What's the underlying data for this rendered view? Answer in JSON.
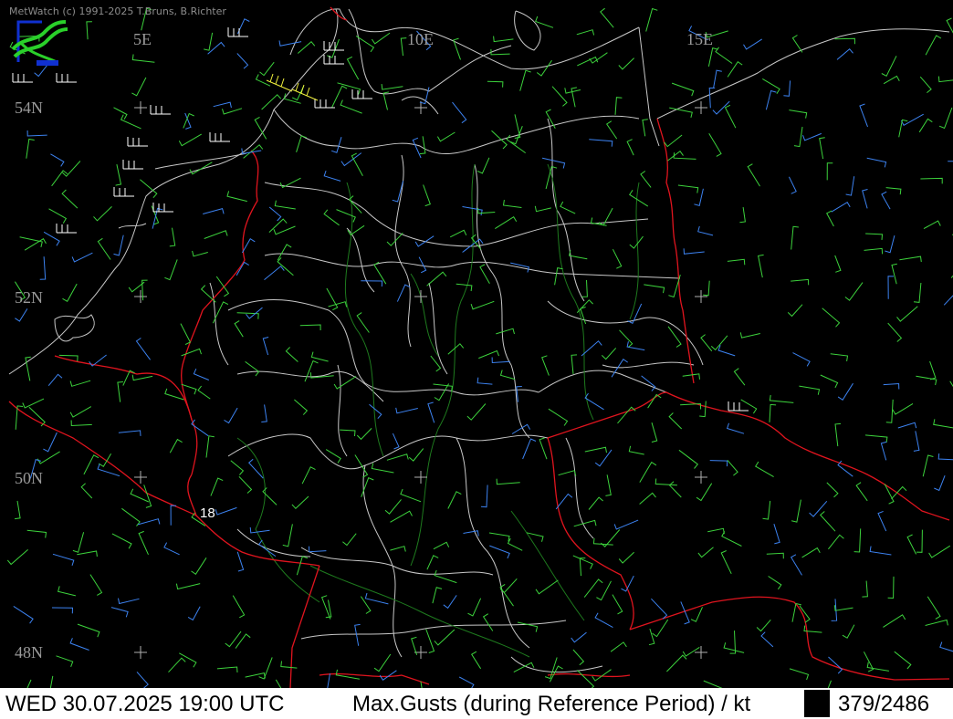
{
  "app": {
    "credit": "MetWatch  (c) 1991-2025 T.Bruns, B.Richter"
  },
  "map": {
    "graticule_labels": {
      "lon": [
        "5E",
        "10E",
        "15E"
      ],
      "lat": [
        "54N",
        "52N",
        "50N",
        "48N"
      ]
    },
    "station_value": "18",
    "colors": {
      "background": "#000000",
      "border": "#e0141e",
      "admin": "#c8c8c8",
      "river": "#1e7a1e",
      "wind_green": "#3cd23c",
      "wind_blue": "#3c82f0",
      "wind_white": "#ffffff",
      "wind_yellow": "#f0f03c"
    }
  },
  "status": {
    "datetime": "WED 30.07.2025 19:00 UTC",
    "title": "Max.Gusts (during Reference Period) / kt",
    "count": "379/2486"
  }
}
